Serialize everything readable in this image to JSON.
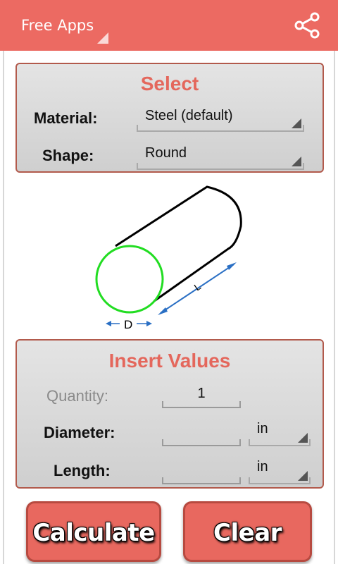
{
  "app_bar": {
    "title": "Free Apps",
    "icons": {
      "share": "share-icon",
      "menu": "dropdown-triangle-icon"
    },
    "color": "#ec6a62"
  },
  "select_panel": {
    "title": "Select",
    "material": {
      "label": "Material:",
      "value": "Steel (default)"
    },
    "shape": {
      "label": "Shape:",
      "value": "Round"
    }
  },
  "diagram": {
    "diameter_label": "D",
    "length_label": "L",
    "cross_section_color": "#22dd22",
    "arrow_color": "#2a6fc4"
  },
  "insert_panel": {
    "title": "Insert Values",
    "quantity": {
      "label": "Quantity:",
      "value": "1"
    },
    "diameter": {
      "label": "Diameter:",
      "value": "",
      "unit": "in"
    },
    "length": {
      "label": "Length:",
      "value": "",
      "unit": "in"
    }
  },
  "buttons": {
    "calculate": "Calculate",
    "clear": "Clear"
  },
  "colors": {
    "accent": "#e4675c",
    "panel_border": "#b25a4c",
    "button": "#e8685f"
  }
}
